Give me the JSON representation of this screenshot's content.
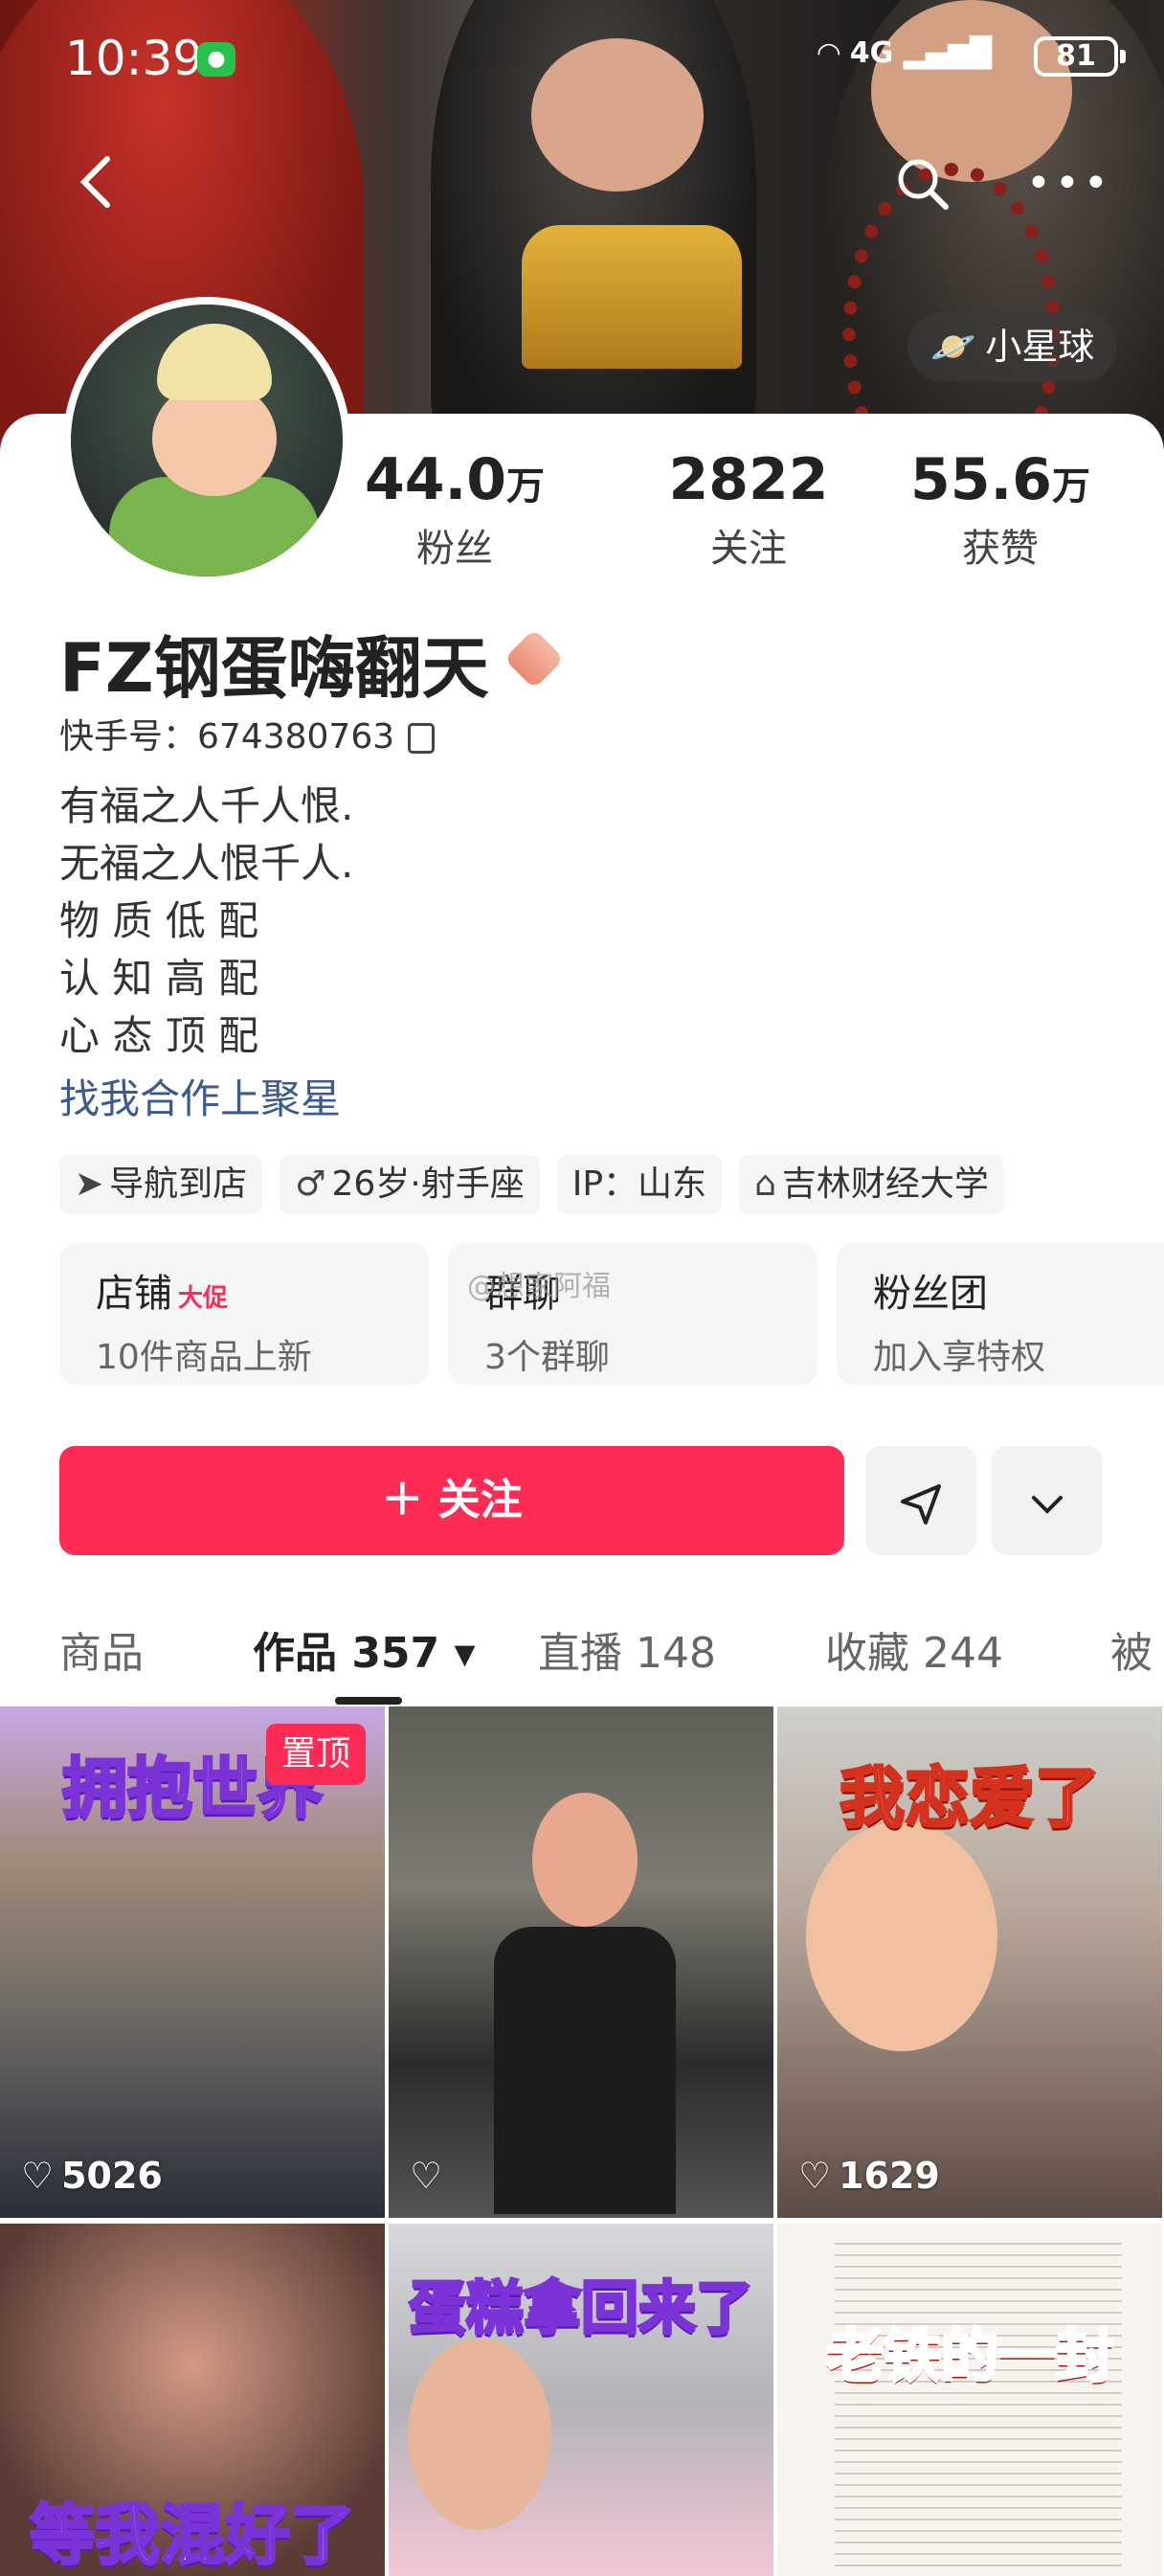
{
  "status_bar": {
    "time": "10:39",
    "network": "4G",
    "battery": "81"
  },
  "header": {
    "back_icon": "chevron-left-icon",
    "search_icon": "search-icon",
    "more_icon": "more-icon",
    "planet_label": "小星球"
  },
  "stats": [
    {
      "value": "44.0",
      "unit": "万",
      "label": "粉丝"
    },
    {
      "value": "2822",
      "unit": "",
      "label": "关注"
    },
    {
      "value": "55.6",
      "unit": "万",
      "label": "获赞"
    }
  ],
  "profile": {
    "name": "FZ钢蛋嗨翻天",
    "kuaishou_id": "快手号：674380763",
    "bio": "有福之人千人恨.\n无福之人恨千人.\n物 质 低 配\n认 知 高 配\n心 态 顶 配",
    "cooperation_link": "找我合作上聚星"
  },
  "tags": [
    {
      "icon": "navigation-icon",
      "label": "导航到店"
    },
    {
      "icon": "male-icon",
      "label": "26岁·射手座"
    },
    {
      "icon": "",
      "label": "IP：山东"
    },
    {
      "icon": "school-icon",
      "label": "吉林财经大学"
    }
  ],
  "boxes": [
    {
      "title": "店铺",
      "hot": "大促",
      "sub": "10件商品上新"
    },
    {
      "title": "群聊",
      "hot": "",
      "sub": "3个群聊",
      "watermark": "@想家阿福"
    },
    {
      "title": "粉丝团",
      "hot": "",
      "sub": "加入享特权"
    }
  ],
  "actions": {
    "follow_label": "关注",
    "follow_icon": "plus-icon",
    "share_icon": "send-icon",
    "dropdown_icon": "chevron-down-icon"
  },
  "tabs": [
    {
      "label": "商品"
    },
    {
      "label": "作品 357 ▾"
    },
    {
      "label": "直播 148"
    },
    {
      "label": "收藏 244"
    },
    {
      "label": "被"
    }
  ],
  "active_tab": "作品 357",
  "videos": [
    {
      "title": "拥抱世界",
      "pinned": "置顶",
      "likes": "5026"
    },
    {
      "title": "",
      "pinned": "",
      "likes": ""
    },
    {
      "title": "我恋爱了",
      "pinned": "",
      "likes": "1629"
    },
    {
      "title": "等我混好了",
      "pinned": "",
      "likes": ""
    },
    {
      "title": "蛋糕拿回来了",
      "pinned": "",
      "likes": ""
    },
    {
      "title": "老铁的一封",
      "pinned": "",
      "likes": ""
    }
  ],
  "colors": {
    "accent": "#fe2c55",
    "link": "#3c5a8e"
  }
}
